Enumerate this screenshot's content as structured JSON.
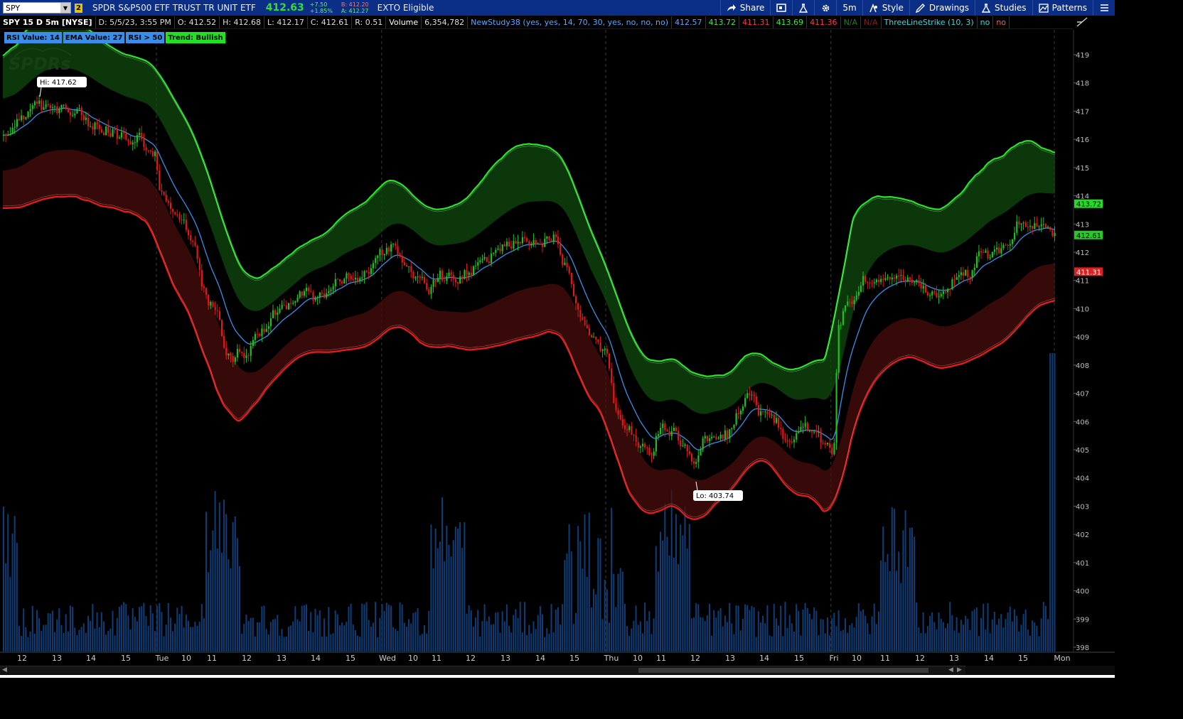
{
  "toolbar": {
    "symbol": "SPY",
    "link_number": "2",
    "description": "SPDR S&P500 ETF TRUST TR UNIT ETF",
    "last": "412.63",
    "change_abs": "+7.50",
    "change_pct": "+1.85%",
    "bid": "B: 412.20",
    "ask": "A: 412.27",
    "exto": "EXTO Eligible",
    "buttons": {
      "share": "Share",
      "timeframe": "5m",
      "style": "Style",
      "drawings": "Drawings",
      "studies": "Studies",
      "patterns": "Patterns"
    }
  },
  "status": {
    "title": "SPY 15 D 5m [NYSE]",
    "date": "D: 5/5/23, 3:55 PM",
    "open": "O: 412.52",
    "high": "H: 412.68",
    "low": "L: 412.17",
    "close": "C: 412.61",
    "range": "R: 0.51",
    "volume_label": "Volume",
    "volume": "6,354,782",
    "study_name": "NewStudy38 (yes, yes, 14, 70, 30, yes, no, no, no)",
    "study_val1": "412.57",
    "study_val2": "413.72",
    "study_val3": "411.31",
    "study_val4": "413.69",
    "study_val5": "411.36",
    "study_val6": "N/A",
    "study_val7": "N/A",
    "tls_name": "ThreeLineStrike (10, 3)",
    "tls_val1": "no",
    "tls_val2": "no"
  },
  "badges": [
    {
      "label": "RSI Value: 14",
      "color": "#3a8ee8"
    },
    {
      "label": "EMA Value: 27",
      "color": "#3a8ee8"
    },
    {
      "label": "RSI > 50",
      "color": "#3a8ee8"
    },
    {
      "label": "Trend: Bullish",
      "color": "#22e022"
    }
  ],
  "watermark": "SPDRs",
  "annotations": {
    "hi": "Hi: 417.62",
    "lo": "Lo: 403.74"
  },
  "price_tags": [
    {
      "label": "413.72",
      "value": 413.72,
      "color": "#22dd22"
    },
    {
      "label": "412.61",
      "value": 412.61,
      "color": "#22cc22"
    },
    {
      "label": "411.31",
      "value": 411.31,
      "color": "#e01f1f"
    }
  ],
  "colors": {
    "up_candle": "#1fbf1f",
    "down_candle": "#e01818",
    "upper_band": "#2ee02e",
    "lower_band": "#e81c1c",
    "ema": "#3a8ee8",
    "volume": "#0f3d78",
    "grid": "#3a3a3a"
  },
  "chart_data": {
    "type": "candlestick",
    "y_range": [
      398,
      419.5
    ],
    "y_ticks": [
      "398",
      "399",
      "400",
      "401",
      "402",
      "403",
      "404",
      "405",
      "406",
      "407",
      "408",
      "409",
      "410",
      "411",
      "412",
      "413",
      "414",
      "415",
      "416",
      "417",
      "418",
      "419"
    ],
    "x_labels": [
      "12",
      "13",
      "14",
      "15",
      "Tue",
      "10",
      "11",
      "12",
      "13",
      "14",
      "15",
      "Wed",
      "10",
      "11",
      "12",
      "13",
      "14",
      "15",
      "Thu",
      "10",
      "11",
      "12",
      "13",
      "14",
      "15",
      "Fri",
      "10",
      "11",
      "12",
      "13",
      "14",
      "15",
      "Mon"
    ],
    "day_separators": [
      "Tue",
      "Wed",
      "Thu",
      "Fri",
      "Mon"
    ],
    "close_anchors": [
      [
        0,
        416.0
      ],
      [
        20,
        417.0
      ],
      [
        45,
        417.2
      ],
      [
        60,
        417.0
      ],
      [
        90,
        416.2
      ],
      [
        120,
        416.0
      ],
      [
        135,
        415.5
      ],
      [
        140,
        414.2
      ],
      [
        160,
        413.0
      ],
      [
        190,
        410.0
      ],
      [
        200,
        408.5
      ],
      [
        215,
        408.4
      ],
      [
        230,
        409.3
      ],
      [
        250,
        410.0
      ],
      [
        270,
        410.6
      ],
      [
        285,
        410.5
      ],
      [
        300,
        411.0
      ],
      [
        320,
        411.1
      ],
      [
        340,
        411.9
      ],
      [
        350,
        412.3
      ],
      [
        370,
        411.2
      ],
      [
        385,
        410.9
      ],
      [
        400,
        411.2
      ],
      [
        420,
        411.5
      ],
      [
        440,
        411.9
      ],
      [
        460,
        412.4
      ],
      [
        470,
        412.5
      ],
      [
        480,
        412.2
      ],
      [
        495,
        412.4
      ],
      [
        505,
        411.5
      ],
      [
        515,
        410.0
      ],
      [
        525,
        409.2
      ],
      [
        540,
        408.5
      ],
      [
        550,
        406.6
      ],
      [
        560,
        405.6
      ],
      [
        570,
        405.0
      ],
      [
        580,
        404.9
      ],
      [
        590,
        405.8
      ],
      [
        600,
        405.6
      ],
      [
        610,
        404.9
      ],
      [
        620,
        404.3
      ],
      [
        630,
        405.3
      ],
      [
        645,
        405.3
      ],
      [
        660,
        406.2
      ],
      [
        670,
        407.0
      ],
      [
        680,
        406.4
      ],
      [
        695,
        406.0
      ],
      [
        705,
        405.1
      ],
      [
        720,
        405.8
      ],
      [
        735,
        405.2
      ],
      [
        745,
        405.0
      ],
      [
        750,
        409.5
      ],
      [
        760,
        410.2
      ],
      [
        780,
        411.2
      ],
      [
        800,
        410.9
      ],
      [
        820,
        410.8
      ],
      [
        840,
        410.6
      ],
      [
        860,
        411.2
      ],
      [
        880,
        411.8
      ],
      [
        900,
        412.3
      ],
      [
        915,
        413.0
      ],
      [
        930,
        413.0
      ],
      [
        945,
        412.6
      ]
    ],
    "candle_count": 946
  }
}
